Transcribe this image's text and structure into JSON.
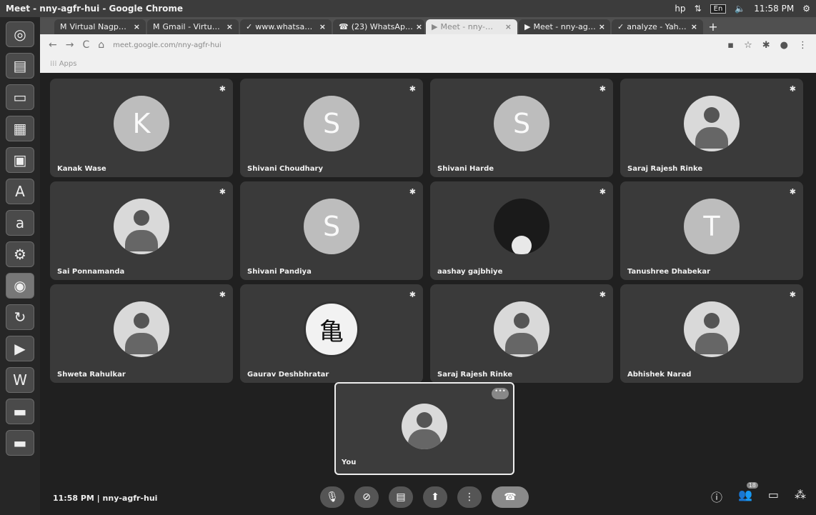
{
  "os": {
    "window_title": "Meet - nny-agfr-hui - Google Chrome",
    "tray_lang": "En",
    "clock": "11:58 PM"
  },
  "launcher": [
    "home-icon",
    "files-icon",
    "document-icon",
    "spreadsheet-icon",
    "presentation-icon",
    "font-viewer-icon",
    "amazon-icon",
    "settings-icon",
    "chrome-icon",
    "update-icon",
    "video-icon",
    "wps-icon",
    "drive-icon",
    "drive-icon-2"
  ],
  "tabs": [
    {
      "label": "Virtual Nagp…",
      "icon": "M"
    },
    {
      "label": "Gmail - Virtu…",
      "icon": "M"
    },
    {
      "label": "www.whatsa…",
      "icon": "✓"
    },
    {
      "label": "(23) WhatsAp…",
      "icon": "☎"
    },
    {
      "label": "Meet - nny-…",
      "icon": "▶",
      "active": true
    },
    {
      "label": "Meet - nny-ag…",
      "icon": "▶"
    },
    {
      "label": "analyze - Yah…",
      "icon": "✓"
    }
  ],
  "address": {
    "url": "meet.google.com/nny-agfr-hui",
    "bookmarks_label": "Apps"
  },
  "participants": [
    {
      "name": "Kanak Wase",
      "initial": "K",
      "kind": "initial"
    },
    {
      "name": "Shivani Choudhary",
      "initial": "S",
      "kind": "initial"
    },
    {
      "name": "Shivani Harde",
      "initial": "S",
      "kind": "initial"
    },
    {
      "name": "Saraj Rajesh Rinke",
      "initial": "",
      "kind": "photo"
    },
    {
      "name": "Sai Ponnamanda",
      "initial": "",
      "kind": "photo"
    },
    {
      "name": "Shivani Pandiya",
      "initial": "S",
      "kind": "initial"
    },
    {
      "name": "aashay gajbhiye",
      "initial": "",
      "kind": "dark"
    },
    {
      "name": "Tanushree Dhabekar",
      "initial": "T",
      "kind": "initial"
    },
    {
      "name": "Shweta Rahulkar",
      "initial": "",
      "kind": "photo"
    },
    {
      "name": "Gaurav Deshbhratar",
      "initial": "亀",
      "kind": "logo"
    },
    {
      "name": "Saraj Rajesh Rinke",
      "initial": "",
      "kind": "photo"
    },
    {
      "name": "Abhishek Narad",
      "initial": "",
      "kind": "photo"
    }
  ],
  "self_tile": {
    "name": "You"
  },
  "bottom": {
    "meeting_info": "11:58 PM  |  nny-agfr-hui",
    "participant_count": "18"
  }
}
